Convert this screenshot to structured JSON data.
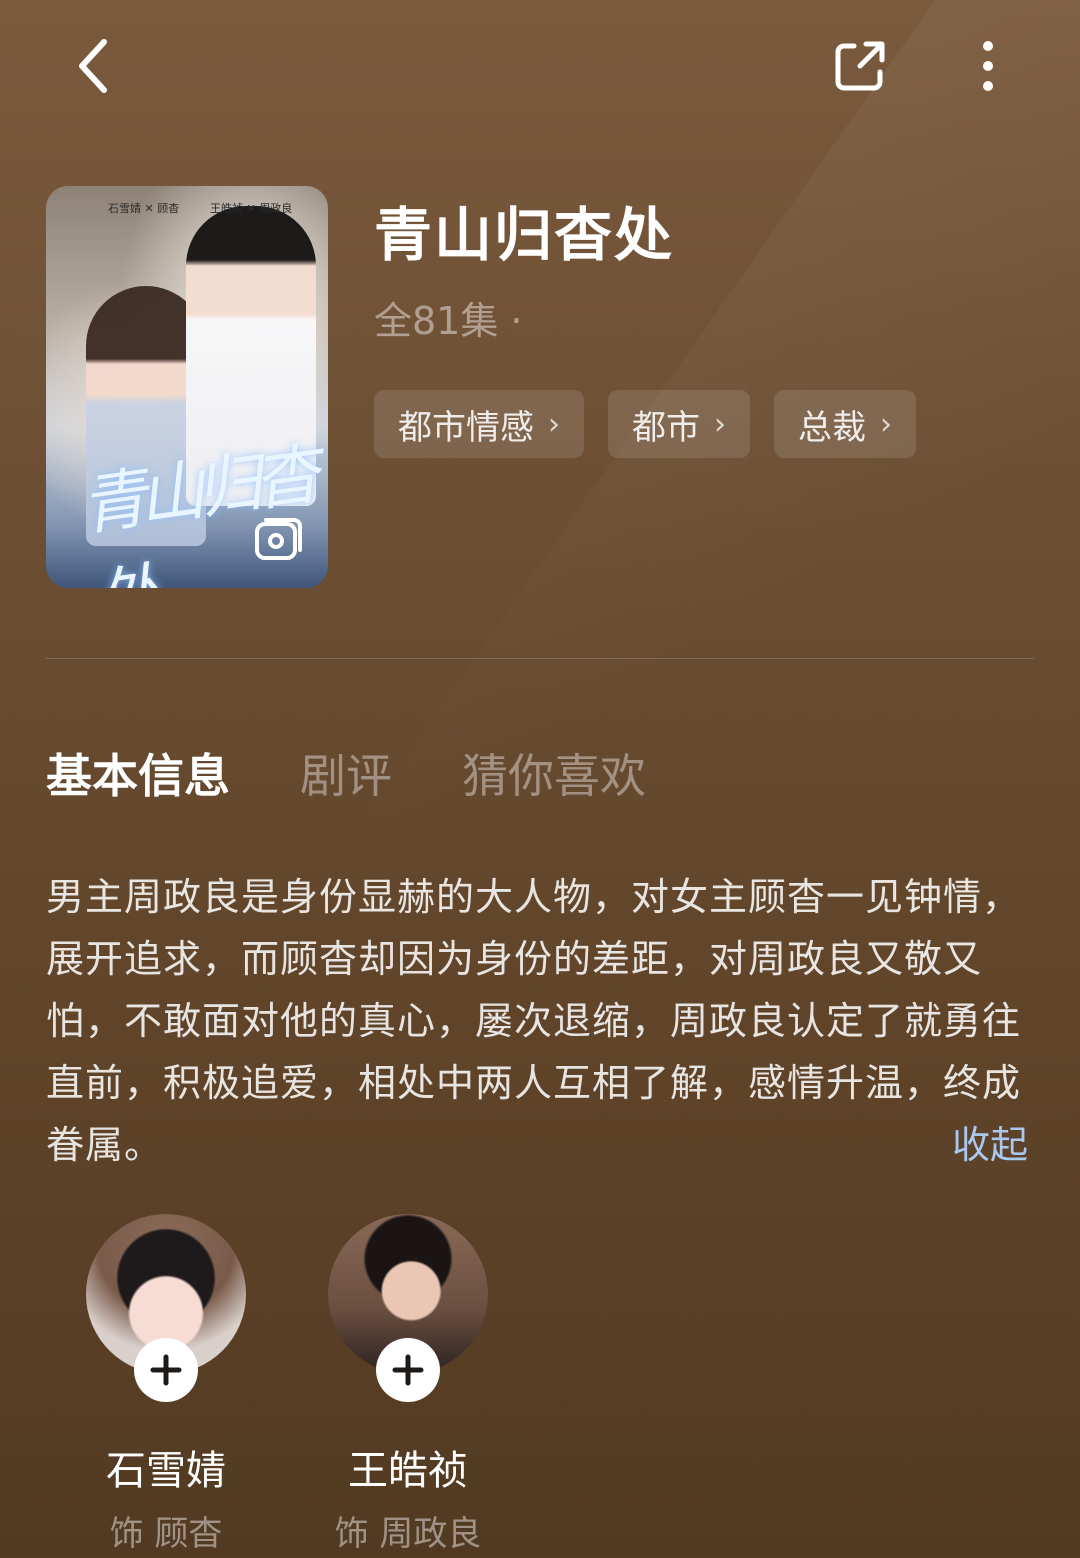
{
  "header": {
    "back_icon": "chevron-left-icon",
    "share_icon": "share-icon",
    "more_icon": "more-vertical-icon"
  },
  "drama": {
    "title": "青山归杳处",
    "episodes": "全81集 ·",
    "poster": {
      "calligraphy": "青山归杳处",
      "credit_left": "石雪婧 ✕ 顾杳",
      "credit_right": "王皓祯 ✕ 周政良"
    },
    "tags": [
      {
        "label": "都市情感"
      },
      {
        "label": "都市"
      },
      {
        "label": "总裁"
      }
    ]
  },
  "tabs": [
    {
      "label": "基本信息",
      "active": true
    },
    {
      "label": "剧评",
      "active": false
    },
    {
      "label": "猜你喜欢",
      "active": false
    }
  ],
  "synopsis": {
    "text": "男主周政良是身份显赫的大人物，对女主顾杳一见钟情，展开追求，而顾杳却因为身份的差距，对周政良又敬又怕，不敢面对他的真心，屡次退缩，周政良认定了就勇往直前，积极追爱，相处中两人互相了解，感情升温，终成眷属。",
    "collapse_label": "收起"
  },
  "cast": [
    {
      "name": "石雪婧",
      "role": "饰 顾杳"
    },
    {
      "name": "王皓祯",
      "role": "饰 周政良"
    }
  ],
  "colors": {
    "accent_link": "#a9c7ef",
    "background_top": "#7a5a3d",
    "background_bottom": "#523a22"
  }
}
